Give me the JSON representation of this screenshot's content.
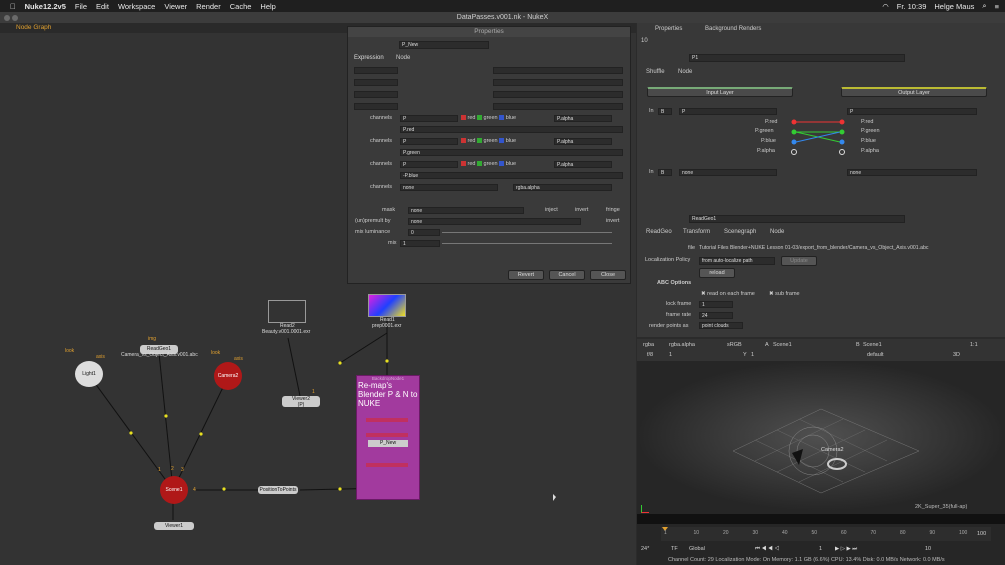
{
  "menubar": {
    "app": "Nuke12.2v5",
    "items": [
      "File",
      "Edit",
      "Workspace",
      "Viewer",
      "Render",
      "Cache",
      "Help"
    ],
    "clock": "Fr. 10:39",
    "user": "Helge Maus"
  },
  "window_title": "DataPasses.v001.nk - NukeX",
  "node_graph": {
    "tab": "Node Graph",
    "nodes": {
      "light": "Light1",
      "readgeo": "ReadGeo1",
      "readgeo_sub": "Camera_vs_Object_Axis.v001.abc",
      "camera": "Camera2",
      "read2": "Read2",
      "read2_sub": "Beauty.v001.0001.exr",
      "read1": "Read1",
      "read1_sub": "prep0001.exr",
      "viewer2": "Viewer2",
      "viewer2_sub": "(P)",
      "scene": "Scene1",
      "viewer1": "Viewer1",
      "pos2pts": "PositionToPoints",
      "backdrop_title": "Re-map's Blender P & N to NUKE",
      "backdrop_hdr": "BackdropNode1",
      "pnew": "P_New"
    },
    "labels": {
      "look": "look",
      "axis": "axis",
      "img": "img",
      "look2": "look",
      "axis2": "axis",
      "one": "1",
      "pinA": "1",
      "pinB": "2",
      "pinC": "3",
      "pinD": "4"
    }
  },
  "prop_float": {
    "title": "Properties",
    "node_name": "P_New",
    "tabs": [
      "Expression",
      "Node"
    ],
    "channels_label": "channels",
    "channels_val": "P",
    "red": "red",
    "green": "green",
    "blue": "blue",
    "alpha": "P.alpha",
    "expr1": "P.red",
    "expr2": "P.green",
    "expr3": "-P.blue",
    "channels4": "none",
    "rgba_alpha": "rgba.alpha",
    "mask": "mask",
    "mask_val": "none",
    "inject": "inject",
    "invert": "invert",
    "fringe": "fringe",
    "unpremult": "(un)premult by",
    "unpremult_val": "none",
    "invert2": "invert",
    "mixlum": "mix luminance",
    "mixlum_val": "0",
    "mix": "mix",
    "mix_val": "1",
    "buttons": [
      "Revert",
      "Cancel",
      "Close"
    ]
  },
  "right_panel": {
    "tabs": [
      "Properties",
      "Background Renders"
    ],
    "count": "10",
    "shuffle": {
      "name": "P1",
      "tabs": [
        "Shuffle",
        "Node"
      ],
      "input": "Input Layer",
      "output": "Output Layer",
      "in_label": "In",
      "in_val": "B",
      "in_layer": "P",
      "out_layer": "P",
      "in_ch": [
        "P.red",
        "P.green",
        "P.blue",
        "P.alpha"
      ],
      "out_ch": [
        "P.red",
        "P.green",
        "P.blue",
        "P.alpha"
      ],
      "in2_val": "B",
      "in2_layer": "none",
      "out2_layer": "none"
    },
    "readgeo": {
      "name": "ReadGeo1",
      "tabs": [
        "ReadGeo",
        "Transform",
        "Scenegraph",
        "Node"
      ],
      "file_label": "file",
      "file": "Tutorial Files Blender+NUKE Lesson 01-03/export_from_blender/Camera_vs_Object_Axis.v001.abc",
      "loc_label": "Localization Policy",
      "loc_val": "from auto-localize path",
      "update": "Update",
      "reload": "reload",
      "abc": "ABC Options",
      "read_frame": "read on each frame",
      "sub_frame": "sub frame",
      "lock_label": "lock frame",
      "lock_val": "1",
      "rate_label": "frame rate",
      "rate_val": "24",
      "render_label": "render points as",
      "render_val": "point clouds"
    }
  },
  "viewer": {
    "chan": "rgba",
    "alpha": "rgba.alpha",
    "cs": "sRGB",
    "a_label": "A",
    "scene": "Scene1",
    "b_label": "B",
    "scene_b": "Scene1",
    "ratio": "1:1",
    "view": "3D",
    "fstop": "f/8",
    "one": "1",
    "y": "Y",
    "yv": "1",
    "default": "default",
    "camera": "Camera2",
    "format": "2K_Super_35(full-ap)",
    "ticks": [
      "1",
      "10",
      "20",
      "30",
      "40",
      "50",
      "60",
      "70",
      "80",
      "90",
      "100"
    ],
    "end": "100",
    "fps": "24*",
    "tf": "TF",
    "global": "Global",
    "cur": "1",
    "ten": "10",
    "status": "Channel Count: 29  Localization Mode: On  Memory: 1.1 GB (6.6%)  CPU: 13.4%  Disk: 0.0 MB/s  Network: 0.0 MB/s"
  }
}
